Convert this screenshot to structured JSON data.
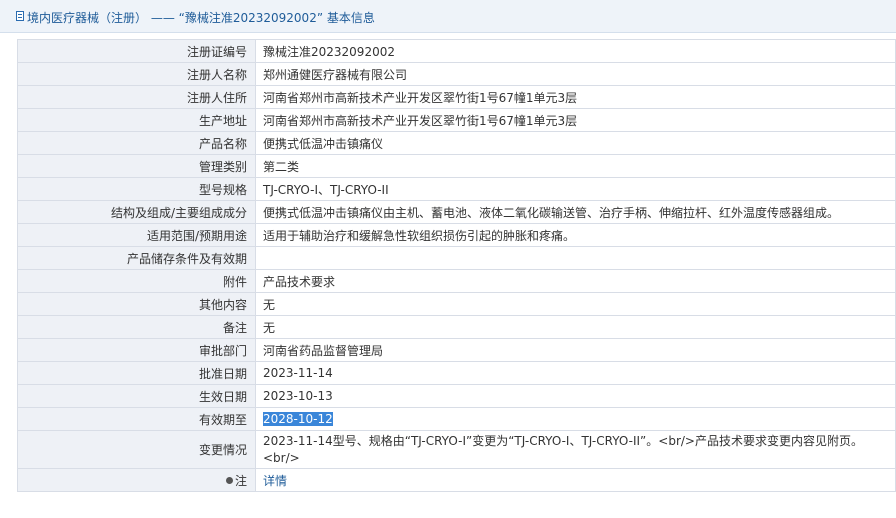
{
  "header": {
    "title": "境内医疗器械（注册） —— “豫械注准20232092002” 基本信息",
    "icon": "document-icon"
  },
  "rows": [
    {
      "label": "注册证编号",
      "value": "豫械注准20232092002"
    },
    {
      "label": "注册人名称",
      "value": "郑州通健医疗器械有限公司"
    },
    {
      "label": "注册人住所",
      "value": "河南省郑州市高新技术产业开发区翠竹街1号67幢1单元3层"
    },
    {
      "label": "生产地址",
      "value": "河南省郑州市高新技术产业开发区翠竹街1号67幢1单元3层"
    },
    {
      "label": "产品名称",
      "value": "便携式低温冲击镇痛仪"
    },
    {
      "label": "管理类别",
      "value": "第二类"
    },
    {
      "label": "型号规格",
      "value": "TJ-CRYO-I、TJ-CRYO-II"
    },
    {
      "label": "结构及组成/主要组成成分",
      "value": "便携式低温冲击镇痛仪由主机、蓄电池、液体二氧化碳输送管、治疗手柄、伸缩拉杆、红外温度传感器组成。"
    },
    {
      "label": "适用范围/预期用途",
      "value": "适用于辅助治疗和缓解急性软组织损伤引起的肿胀和疼痛。"
    },
    {
      "label": "产品储存条件及有效期",
      "value": ""
    },
    {
      "label": "附件",
      "value": "产品技术要求"
    },
    {
      "label": "其他内容",
      "value": "无"
    },
    {
      "label": "备注",
      "value": "无"
    },
    {
      "label": "审批部门",
      "value": "河南省药品监督管理局"
    },
    {
      "label": "批准日期",
      "value": "2023-11-14"
    },
    {
      "label": "生效日期",
      "value": "2023-10-13"
    },
    {
      "label": "有效期至",
      "value": "2028-10-12"
    },
    {
      "label": "变更情况",
      "value": "2023-11-14型号、规格由“TJ-CRYO-I”变更为“TJ-CRYO-I、TJ-CRYO-II”。<br/>产品技术要求变更内容见附页。<br/>"
    }
  ],
  "note": {
    "label": "注",
    "link": "详情",
    "icon": "pin-icon"
  },
  "colors": {
    "header_bg": "#eef3f9",
    "label_bg": "#eef1f6",
    "link": "#1f5c99",
    "selection": "#3a86d9"
  }
}
